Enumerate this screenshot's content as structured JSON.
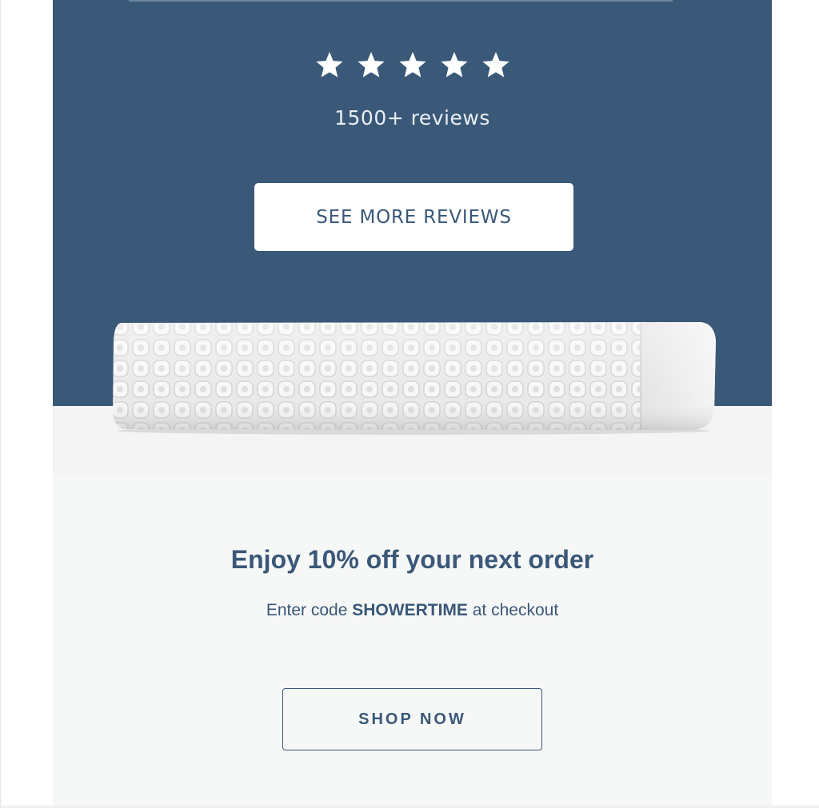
{
  "reviews": {
    "rating": 5,
    "max_rating": 5,
    "star_icon": "star-icon",
    "count_text": "1500+ reviews",
    "button_label": "SEE MORE REVIEWS"
  },
  "product": {
    "image": "folded-waffle-towel"
  },
  "promo": {
    "title": "Enjoy 10% off your next order",
    "sub_prefix": "Enter code ",
    "code": "SHOWERTIME",
    "sub_suffix": " at checkout",
    "button_label": "SHOP NOW"
  },
  "colors": {
    "brand_navy": "#3a5878",
    "white": "#ffffff",
    "promo_bg": "#f6f7f7",
    "product_bg": "#f4f4f4"
  }
}
